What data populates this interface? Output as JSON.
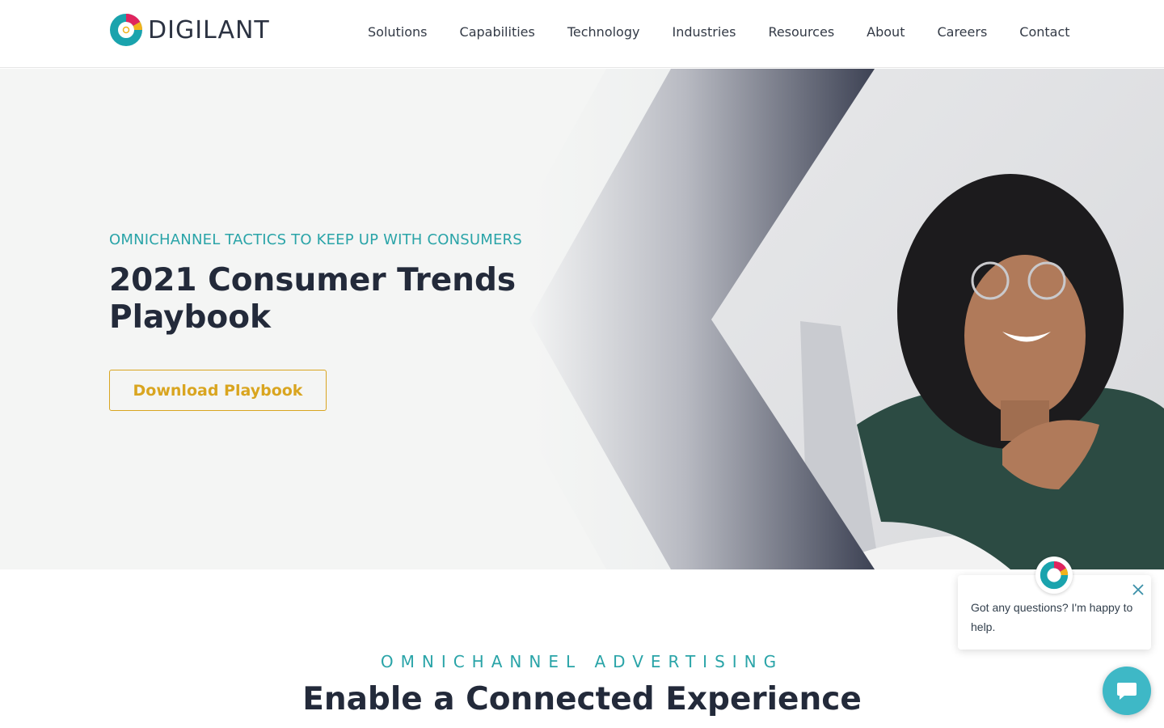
{
  "brand": {
    "name": "DIGILANT",
    "logo_icon": "digilant-ring-logo"
  },
  "nav": {
    "items": [
      {
        "label": "Solutions"
      },
      {
        "label": "Capabilities"
      },
      {
        "label": "Technology"
      },
      {
        "label": "Industries"
      },
      {
        "label": "Resources"
      },
      {
        "label": "About"
      },
      {
        "label": "Careers"
      },
      {
        "label": "Contact"
      }
    ]
  },
  "hero": {
    "eyebrow": "OMNICHANNEL TACTICS TO KEEP UP WITH CONSUMERS",
    "title": "2021 Consumer Trends Playbook",
    "cta_label": "Download Playbook",
    "image_icon": "smiling-woman-at-laptop-photo"
  },
  "section": {
    "eyebrow": "OMNICHANNEL ADVERTISING",
    "title": "Enable a Connected Experience"
  },
  "chat": {
    "message": "Got any questions? I'm happy to help.",
    "close_icon": "close-icon",
    "launcher_icon": "chat-bubble-icon"
  },
  "colors": {
    "accent_teal": "#2aa4a8",
    "accent_gold": "#d9a520",
    "heading": "#232a3a",
    "hero_bg": "#f4f5f4",
    "launcher": "#3eb8c6"
  }
}
